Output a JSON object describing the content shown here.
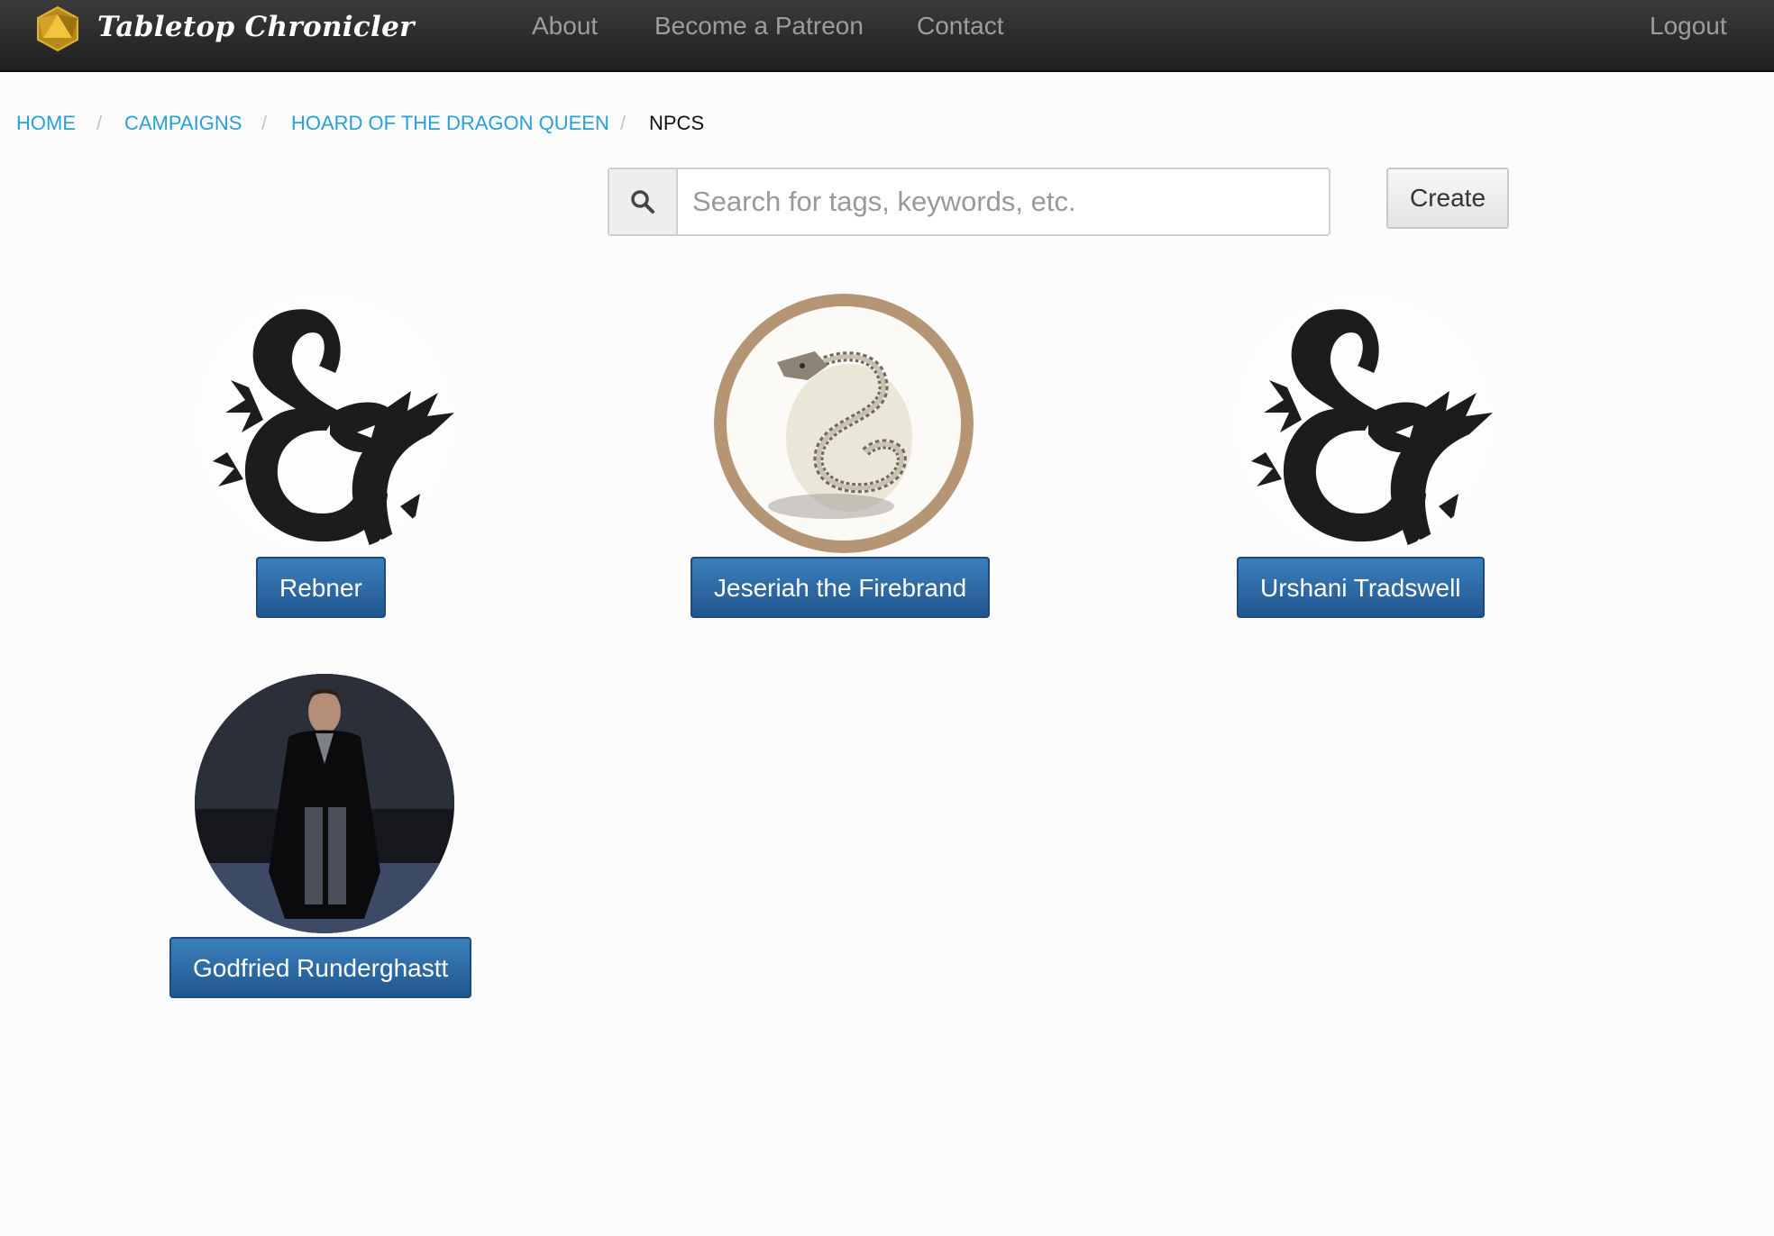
{
  "app": {
    "brand": "Tabletop Chronicler",
    "logo_icon": "d20-icon",
    "accent_color": "#2a9fd6",
    "button_color": "#2c6aa8"
  },
  "nav": {
    "about": "About",
    "patreon": "Become a Patreon",
    "contact": "Contact",
    "logout": "Logout"
  },
  "breadcrumb": {
    "home": "HOME",
    "campaigns": "CAMPAIGNS",
    "campaign": "HOARD OF THE DRAGON QUEEN",
    "current": "NPCS",
    "separator": "/"
  },
  "search": {
    "icon": "search-icon",
    "placeholder": "Search for tags, keywords, etc.",
    "value": ""
  },
  "toolbar": {
    "create_label": "Create"
  },
  "npcs": [
    {
      "name": "Rebner",
      "portrait": "ampersand-dragon-logo"
    },
    {
      "name": "Jeseriah the Firebrand",
      "portrait": "bone-serpent-token"
    },
    {
      "name": "Urshani Tradswell",
      "portrait": "ampersand-dragon-logo"
    },
    {
      "name": "Godfried Runderghastt",
      "portrait": "man-in-dark-coat-photo"
    }
  ]
}
